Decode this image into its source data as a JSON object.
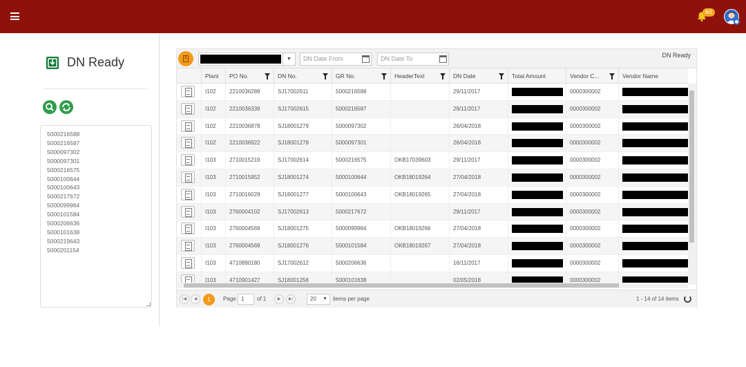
{
  "header": {
    "notification_count": "60",
    "colors": {
      "brand": "#8e1209",
      "accent": "#f39a1a",
      "success": "#2e9d4d"
    }
  },
  "sidebar": {
    "title": "DN Ready",
    "ids": [
      "5000216588",
      "5000216587",
      "5000097302",
      "5000097301",
      "5000216575",
      "5000100644",
      "5000100643",
      "5000217672",
      "5000099964",
      "5000101584",
      "5000206636",
      "5000101638",
      "5000219643",
      "5000201154"
    ]
  },
  "grid": {
    "label": "DN Ready",
    "date_from_placeholder": "DN Date From",
    "date_to_placeholder": "DN Date To",
    "columns": [
      "Plant",
      "PO No.",
      "DN No.",
      "GR No.",
      "HeaderText",
      "DN Date",
      "Total Amount",
      "Vendor C...",
      "Vendor Name"
    ],
    "rows": [
      [
        "I102",
        "2210036289",
        "SJ17002611",
        "5000216588",
        "",
        "29/11/2017",
        "",
        "0000300002",
        ""
      ],
      [
        "I102",
        "2210036339",
        "SJ17002615",
        "5000216587",
        "",
        "29/11/2017",
        "",
        "0000300002",
        ""
      ],
      [
        "I102",
        "2210036878",
        "SJ18001279",
        "5000097302",
        "",
        "26/04/2018",
        "",
        "0000300002",
        ""
      ],
      [
        "I102",
        "2210036922",
        "SJ18001278",
        "5000097301",
        "",
        "26/04/2018",
        "",
        "0000300002",
        ""
      ],
      [
        "I103",
        "2710015219",
        "SJ17002614",
        "5000216575",
        "OKB17039603",
        "29/11/2017",
        "",
        "0000300002",
        ""
      ],
      [
        "I103",
        "2710015952",
        "SJ18001274",
        "5000100644",
        "OKB18019264",
        "27/04/2018",
        "",
        "0000300002",
        ""
      ],
      [
        "I103",
        "2710016029",
        "SJ18001277",
        "5000100643",
        "OKB18019265",
        "27/04/2018",
        "",
        "0000300002",
        ""
      ],
      [
        "I103",
        "2760004102",
        "SJ17002613",
        "5000217672",
        "",
        "29/11/2017",
        "",
        "0000300002",
        ""
      ],
      [
        "I103",
        "2760004569",
        "SJ18001275",
        "5000099964",
        "OKB18019266",
        "27/04/2018",
        "",
        "0000300002",
        ""
      ],
      [
        "I103",
        "2760004569",
        "SJ18001276",
        "5000101584",
        "OKB18019267",
        "27/04/2018",
        "",
        "0000300002",
        ""
      ],
      [
        "I103",
        "4710890180",
        "SJ17002612",
        "5000206636",
        "",
        "16/11/2017",
        "",
        "0000300002",
        ""
      ],
      [
        "I103",
        "4710901427",
        "SJ18001256",
        "5000101638",
        "",
        "02/05/2018",
        "",
        "0000300002",
        ""
      ]
    ]
  },
  "pager": {
    "current_page": "1",
    "page_label": "Page",
    "page_value": "1",
    "of_label": "of 1",
    "page_size": "20",
    "items_per_page_label": "items per page",
    "summary": "1 - 14 of 14 items"
  }
}
